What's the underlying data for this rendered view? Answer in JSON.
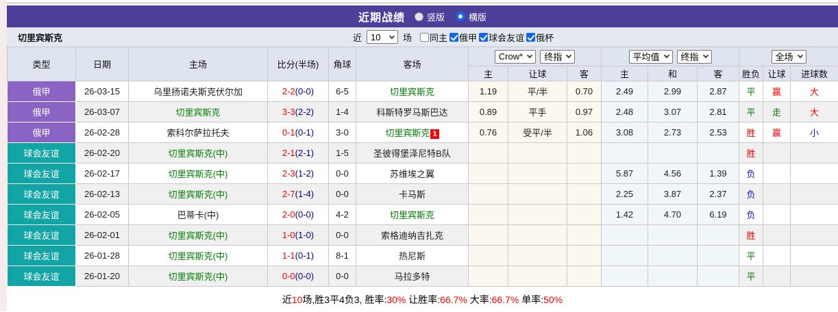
{
  "colors": {
    "header_purple": "#4B3F99",
    "league_purple": "#8A63C5",
    "friendly_teal": "#12A5A5",
    "team_green": "#008000",
    "score_red": "#FF0000",
    "half_navy": "#00008B",
    "red": "#FF0000",
    "green": "#008000",
    "blue": "#1414D0",
    "black": "#000000",
    "crow_col_bg": "#FCF7EF",
    "avg_col_bg": "#F0F7FA"
  },
  "title_bar": {
    "title": "近期战绩",
    "radios": [
      {
        "label": "竖版",
        "checked": false
      },
      {
        "label": "横版",
        "checked": true
      }
    ]
  },
  "controls": {
    "team": "切里宾斯克",
    "near_label": "近",
    "count_value": "10",
    "games_label": "场",
    "same_home": {
      "label": "同主",
      "checked": false
    },
    "filters": [
      {
        "label": "俄甲",
        "checked": true
      },
      {
        "label": "球会友谊",
        "checked": true
      },
      {
        "label": "俄杯",
        "checked": true
      }
    ]
  },
  "table": {
    "col_headers": {
      "type": "类型",
      "date": "日期",
      "home": "主场",
      "score": "比分(半场)",
      "corner": "角球",
      "away": "客场"
    },
    "selects": {
      "source": "Crow*",
      "final1": "终指",
      "average": "平均值",
      "final2": "终指",
      "scope": "全场"
    },
    "sub_headers": [
      "主",
      "让球",
      "客",
      "主",
      "和",
      "客",
      "胜负",
      "让球",
      "进球数"
    ],
    "rows": [
      {
        "league": "俄甲",
        "league_type": "league",
        "date": "26-03-15",
        "home": {
          "name": "乌里扬诺夫斯克伏尔加",
          "highlight": false
        },
        "score": {
          "full": "2-2",
          "half": "(0-0)"
        },
        "corner": "6-5",
        "away": {
          "name": "切里宾斯克",
          "highlight": true,
          "badge": ""
        },
        "crow": {
          "home": "1.19",
          "handicap": "平/半",
          "away": "0.70"
        },
        "avg": {
          "home": "2.49",
          "draw": "2.99",
          "away": "2.87"
        },
        "result": {
          "text": "平",
          "color": "green"
        },
        "handicap_result": {
          "text": "赢",
          "color": "red"
        },
        "goals": {
          "text": "大",
          "color": "red"
        }
      },
      {
        "league": "俄甲",
        "league_type": "league",
        "date": "26-03-07",
        "home": {
          "name": "切里宾斯克",
          "highlight": true
        },
        "score": {
          "full": "3-3",
          "half": "(2-2)"
        },
        "corner": "1-4",
        "away": {
          "name": "科斯特罗马斯巴达",
          "highlight": false,
          "badge": ""
        },
        "crow": {
          "home": "0.89",
          "handicap": "平手",
          "away": "0.97"
        },
        "avg": {
          "home": "2.48",
          "draw": "3.07",
          "away": "2.81"
        },
        "result": {
          "text": "平",
          "color": "green"
        },
        "handicap_result": {
          "text": "走",
          "color": "green"
        },
        "goals": {
          "text": "大",
          "color": "red"
        }
      },
      {
        "league": "俄甲",
        "league_type": "league",
        "date": "26-02-28",
        "home": {
          "name": "索科尔萨拉托夫",
          "highlight": false
        },
        "score": {
          "full": "0-1",
          "half": "(0-1)"
        },
        "corner": "3-0",
        "away": {
          "name": "切里宾斯克",
          "highlight": true,
          "badge": "1"
        },
        "crow": {
          "home": "0.76",
          "handicap": "受平/半",
          "away": "1.06"
        },
        "avg": {
          "home": "3.08",
          "draw": "2.73",
          "away": "2.53"
        },
        "result": {
          "text": "胜",
          "color": "red"
        },
        "handicap_result": {
          "text": "赢",
          "color": "red"
        },
        "goals": {
          "text": "小",
          "color": "blue"
        }
      },
      {
        "league": "球会友谊",
        "league_type": "friendly",
        "date": "26-02-20",
        "home": {
          "name": "切里宾斯克(中)",
          "highlight": true
        },
        "score": {
          "full": "2-1",
          "half": "(2-1)"
        },
        "corner": "1-5",
        "away": {
          "name": "圣彼得堡泽尼特B队",
          "highlight": false,
          "badge": ""
        },
        "crow": {
          "home": "",
          "handicap": "",
          "away": ""
        },
        "avg": {
          "home": "",
          "draw": "",
          "away": ""
        },
        "result": {
          "text": "胜",
          "color": "red"
        },
        "handicap_result": {
          "text": "",
          "color": "black"
        },
        "goals": {
          "text": "",
          "color": "black"
        }
      },
      {
        "league": "球会友谊",
        "league_type": "friendly",
        "date": "26-02-17",
        "home": {
          "name": "切里宾斯克(中)",
          "highlight": true
        },
        "score": {
          "full": "2-3",
          "half": "(1-2)"
        },
        "corner": "0-0",
        "away": {
          "name": "苏维埃之翼",
          "highlight": false,
          "badge": ""
        },
        "crow": {
          "home": "",
          "handicap": "",
          "away": ""
        },
        "avg": {
          "home": "5.87",
          "draw": "4.56",
          "away": "1.39"
        },
        "result": {
          "text": "负",
          "color": "blue"
        },
        "handicap_result": {
          "text": "",
          "color": "black"
        },
        "goals": {
          "text": "",
          "color": "black"
        }
      },
      {
        "league": "球会友谊",
        "league_type": "friendly",
        "date": "26-02-13",
        "home": {
          "name": "切里宾斯克(中)",
          "highlight": true
        },
        "score": {
          "full": "2-7",
          "half": "(1-4)"
        },
        "corner": "0-0",
        "away": {
          "name": "卡马斯",
          "highlight": false,
          "badge": ""
        },
        "crow": {
          "home": "",
          "handicap": "",
          "away": ""
        },
        "avg": {
          "home": "2.25",
          "draw": "3.87",
          "away": "2.37"
        },
        "result": {
          "text": "负",
          "color": "blue"
        },
        "handicap_result": {
          "text": "",
          "color": "black"
        },
        "goals": {
          "text": "",
          "color": "black"
        }
      },
      {
        "league": "球会友谊",
        "league_type": "friendly",
        "date": "26-02-05",
        "home": {
          "name": "巴蒂卡(中)",
          "highlight": false
        },
        "score": {
          "full": "2-0",
          "half": "(0-0)"
        },
        "corner": "4-2",
        "away": {
          "name": "切里宾斯克",
          "highlight": true,
          "badge": ""
        },
        "crow": {
          "home": "",
          "handicap": "",
          "away": ""
        },
        "avg": {
          "home": "1.42",
          "draw": "4.70",
          "away": "6.19"
        },
        "result": {
          "text": "负",
          "color": "blue"
        },
        "handicap_result": {
          "text": "",
          "color": "black"
        },
        "goals": {
          "text": "",
          "color": "black"
        }
      },
      {
        "league": "球会友谊",
        "league_type": "friendly",
        "date": "26-02-01",
        "home": {
          "name": "切里宾斯克(中)",
          "highlight": true
        },
        "score": {
          "full": "1-0",
          "half": "(1-0)"
        },
        "corner": "0-0",
        "away": {
          "name": "索格迪纳吉扎克",
          "highlight": false,
          "badge": ""
        },
        "crow": {
          "home": "",
          "handicap": "",
          "away": ""
        },
        "avg": {
          "home": "",
          "draw": "",
          "away": ""
        },
        "result": {
          "text": "胜",
          "color": "red"
        },
        "handicap_result": {
          "text": "",
          "color": "black"
        },
        "goals": {
          "text": "",
          "color": "black"
        }
      },
      {
        "league": "球会友谊",
        "league_type": "friendly",
        "date": "26-01-28",
        "home": {
          "name": "切里宾斯克(中)",
          "highlight": true
        },
        "score": {
          "full": "1-1",
          "half": "(0-1)"
        },
        "corner": "8-1",
        "away": {
          "name": "热尼斯",
          "highlight": false,
          "badge": ""
        },
        "crow": {
          "home": "",
          "handicap": "",
          "away": ""
        },
        "avg": {
          "home": "",
          "draw": "",
          "away": ""
        },
        "result": {
          "text": "平",
          "color": "green"
        },
        "handicap_result": {
          "text": "",
          "color": "black"
        },
        "goals": {
          "text": "",
          "color": "black"
        }
      },
      {
        "league": "球会友谊",
        "league_type": "friendly",
        "date": "26-01-20",
        "home": {
          "name": "切里宾斯克(中)",
          "highlight": true
        },
        "score": {
          "full": "0-0",
          "half": "(0-0)"
        },
        "corner": "0-0",
        "away": {
          "name": "马拉多特",
          "highlight": false,
          "badge": ""
        },
        "crow": {
          "home": "",
          "handicap": "",
          "away": ""
        },
        "avg": {
          "home": "",
          "draw": "",
          "away": ""
        },
        "result": {
          "text": "平",
          "color": "green"
        },
        "handicap_result": {
          "text": "",
          "color": "black"
        },
        "goals": {
          "text": "",
          "color": "black"
        }
      }
    ]
  },
  "footer": {
    "segments": [
      {
        "text": "近",
        "color": "black"
      },
      {
        "text": "10",
        "color": "red"
      },
      {
        "text": "场,胜3平4负3, 胜率:",
        "color": "black"
      },
      {
        "text": "30%",
        "color": "red"
      },
      {
        "text": " 让胜率:",
        "color": "black"
      },
      {
        "text": "66.7%",
        "color": "red"
      },
      {
        "text": " 大率:",
        "color": "black"
      },
      {
        "text": "66.7%",
        "color": "red"
      },
      {
        "text": " 单率:",
        "color": "black"
      },
      {
        "text": "50%",
        "color": "red"
      }
    ]
  }
}
